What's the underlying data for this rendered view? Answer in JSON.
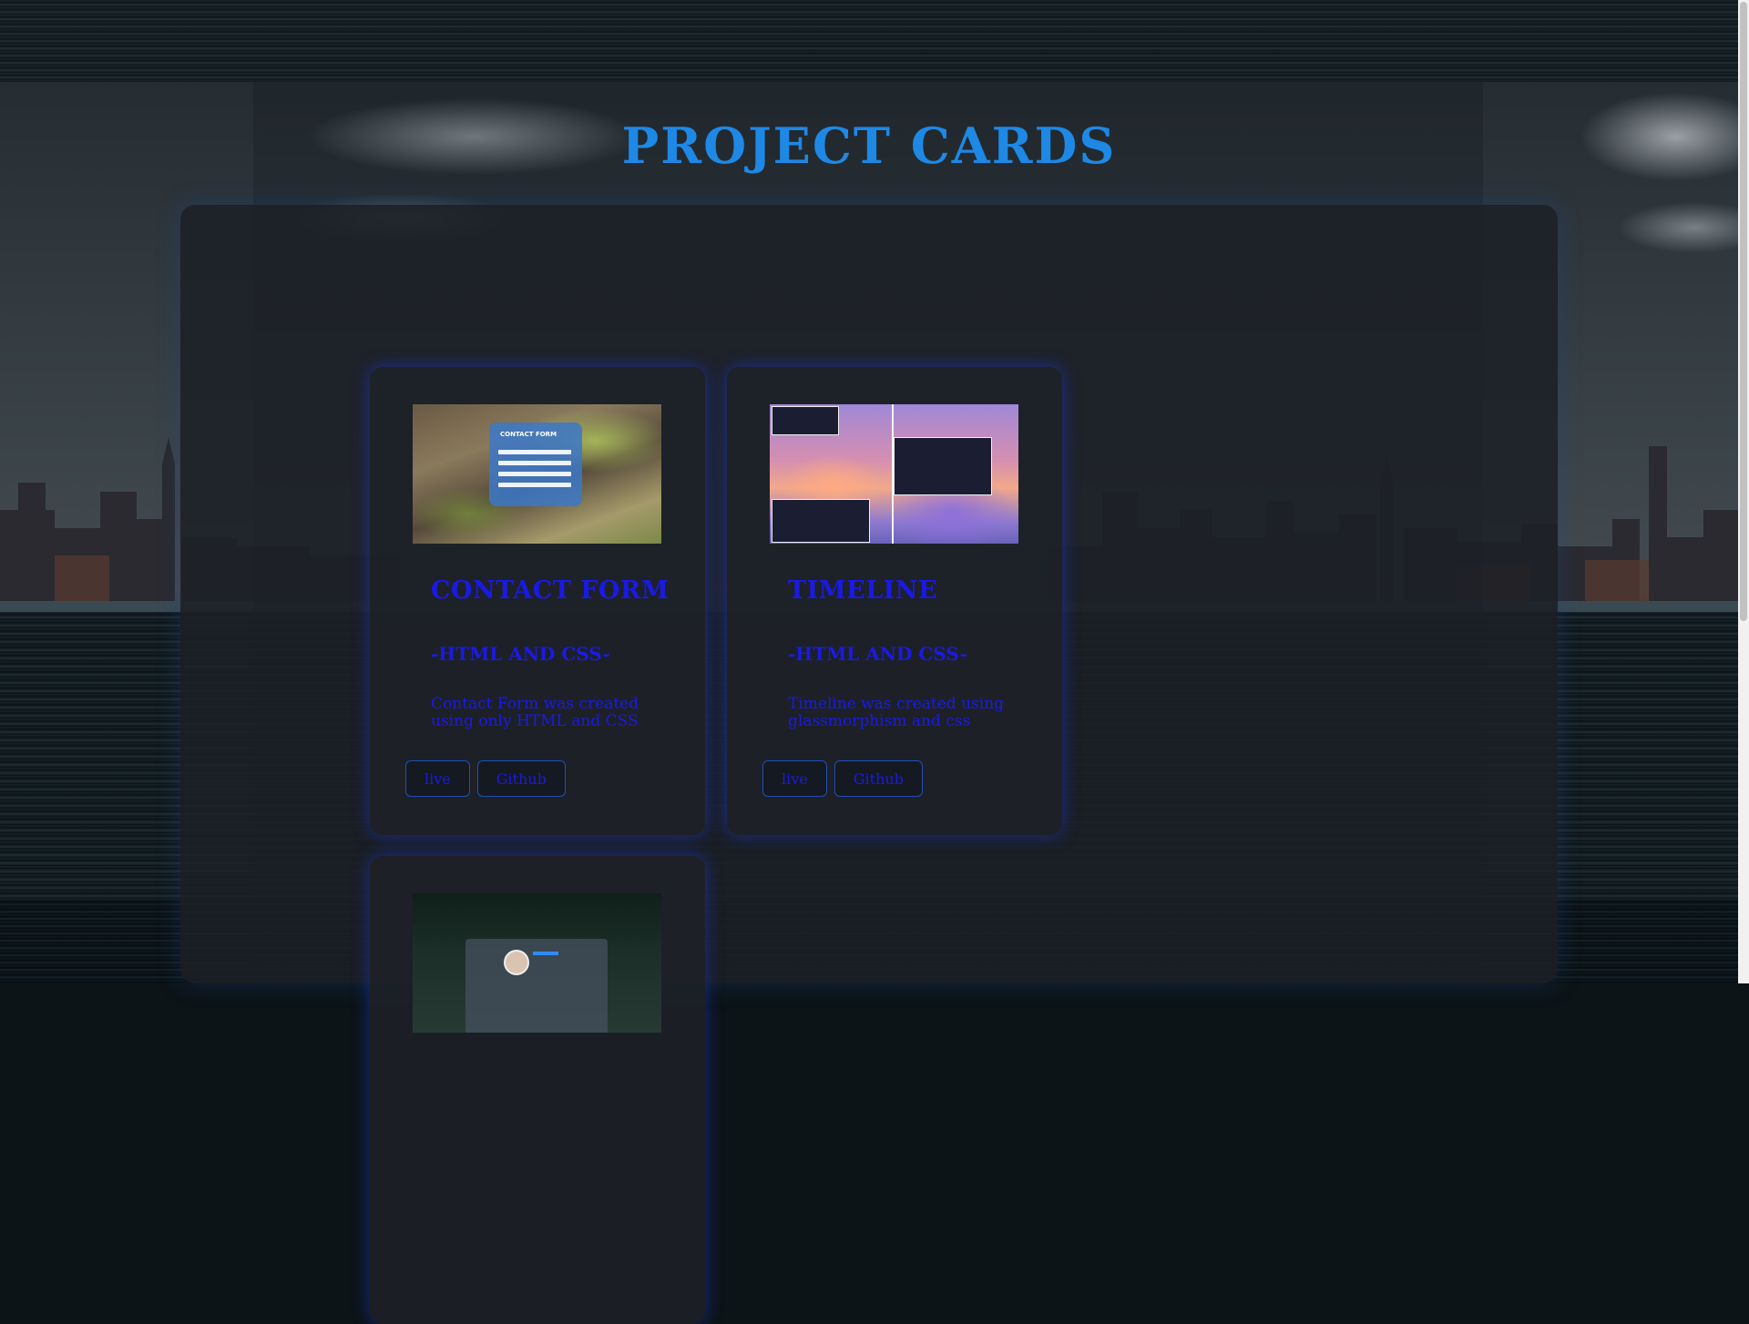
{
  "page": {
    "title": "PROJECT CARDS"
  },
  "colors": {
    "title": "#1e88e5",
    "card_text": "#1a1ae6",
    "card_glow": "#1e3ce6",
    "panel_bg": "#1c2026"
  },
  "cards": [
    {
      "image_icon": "contact-form-thumbnail",
      "thumbnail_label": "CONTACT FORM",
      "title": "CONTACT FORM",
      "subtitle": "-HTML AND CSS-",
      "description": "Contact Form was created using only HTML and CSS",
      "live_label": "live",
      "github_label": "Github"
    },
    {
      "image_icon": "timeline-thumbnail",
      "thumbnail_label": "",
      "title": "TIMELINE",
      "subtitle": "-HTML AND CSS-",
      "description": "Timeline was created using glassmorphism and css",
      "live_label": "live",
      "github_label": "Github"
    },
    {
      "image_icon": "portfolio-thumbnail",
      "thumbnail_label": "",
      "title": "",
      "subtitle": "",
      "description": "",
      "live_label": "",
      "github_label": ""
    }
  ]
}
